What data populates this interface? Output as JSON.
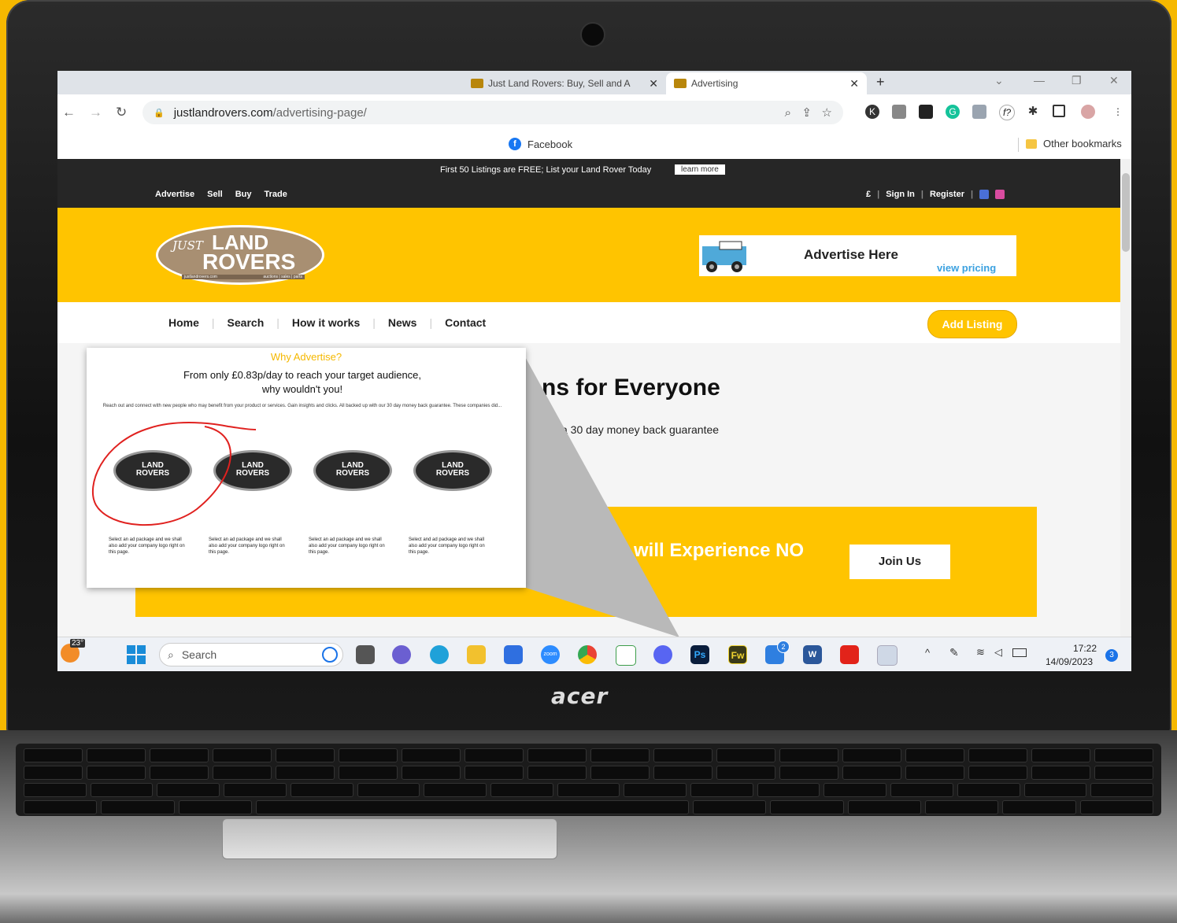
{
  "browser": {
    "tabs": [
      {
        "label": "Just Land Rovers: Buy, Sell and A",
        "active": false
      },
      {
        "label": "Advertising",
        "active": true
      }
    ],
    "new_tab": "+",
    "url_domain": "justlandrovers.com",
    "url_path": "/advertising-page/",
    "bookmark": "Facebook",
    "other_bookmarks": "Other bookmarks"
  },
  "site": {
    "promo_text": "First 50 Listings are FREE; List your Land Rover Today",
    "promo_button": "learn more",
    "top_nav": [
      "Advertise",
      "Sell",
      "Buy",
      "Trade"
    ],
    "currency": "£",
    "sign_in": "Sign In",
    "register": "Register",
    "logo_line1": "LAND",
    "logo_line2": "ROVERS",
    "logo_just": "JUST",
    "logo_sub1": "justlandrovers.com",
    "logo_sub2": "auctions | sales | parts",
    "ad_title": "Advertise Here",
    "ad_link": "view pricing",
    "main_nav": [
      "Home",
      "Search",
      "How it works",
      "News",
      "Contact"
    ],
    "add_listing": "Add Listing",
    "headline": "lans for Everyone",
    "subline": "a 30 day money back guarantee",
    "banner_text": "will Experience NO",
    "join_button": "Join Us"
  },
  "popup": {
    "kicker": "Why Advertise?",
    "title_line1": "From only £0.83p/day to reach your target audience,",
    "title_line2": "why wouldn't you!",
    "body": "Reach out and connect with new people who may benefit from your product or services. Gain insights and clicks. All backed up with our 30 day money back guarantee. These companies did...",
    "logo_line1": "LAND",
    "logo_line2": "ROVERS",
    "captions": [
      "Select an ad package and we shall also add your company logo right on this page.",
      "Select an ad package and we shall also add your company logo right on this page.",
      "Select an ad package and we shall also add your company logo right on this page.",
      "Select and ad package and we shall also add your company logo right on this page."
    ]
  },
  "taskbar": {
    "weather_temp": "23°",
    "search_placeholder": "Search",
    "time": "17:22",
    "date": "14/09/2023",
    "notification_count": "3",
    "mail_badge": "2",
    "ps_label": "Ps",
    "fw_label": "Fw",
    "word_label": "W",
    "zoom_label": "zoom"
  },
  "laptop": {
    "brand": "acer"
  },
  "colors": {
    "brand_yellow": "#ffc400",
    "dark_bar": "#262626",
    "popup_kicker": "#f5b800",
    "circle_red": "#e0211f"
  }
}
